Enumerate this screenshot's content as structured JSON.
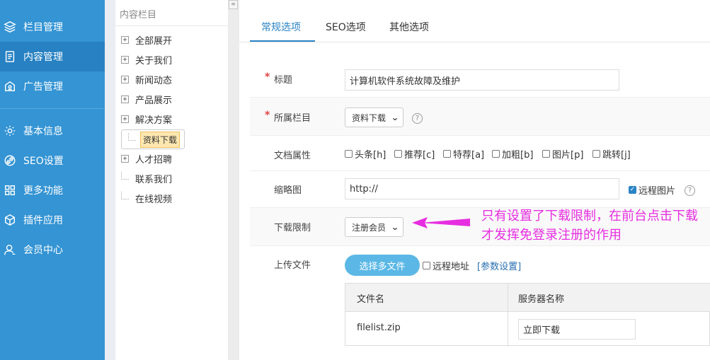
{
  "sidebar": {
    "items": [
      {
        "label": "栏目管理",
        "icon": "layers-icon"
      },
      {
        "label": "内容管理",
        "icon": "document-icon"
      },
      {
        "label": "广告管理",
        "icon": "ad-icon"
      },
      {
        "label": "基本信息",
        "icon": "gear-icon"
      },
      {
        "label": "SEO设置",
        "icon": "link-icon"
      },
      {
        "label": "更多功能",
        "icon": "grid-icon"
      },
      {
        "label": "插件应用",
        "icon": "cube-icon"
      },
      {
        "label": "会员中心",
        "icon": "user-icon"
      }
    ],
    "active": "内容管理"
  },
  "tree": {
    "title": "内容栏目",
    "nodes": [
      {
        "label": "全部展开",
        "expandable": true
      },
      {
        "label": "关于我们",
        "expandable": true
      },
      {
        "label": "新闻动态",
        "expandable": true
      },
      {
        "label": "产品展示",
        "expandable": true
      },
      {
        "label": "解决方案",
        "expandable": true
      },
      {
        "label": "资料下载",
        "expandable": false,
        "selected": true
      },
      {
        "label": "人才招聘",
        "expandable": true
      },
      {
        "label": "联系我们",
        "expandable": false
      },
      {
        "label": "在线视频",
        "expandable": false
      }
    ]
  },
  "tabs": [
    {
      "label": "常规选项",
      "active": true
    },
    {
      "label": "SEO选项"
    },
    {
      "label": "其他选项"
    }
  ],
  "form": {
    "title": {
      "label": "标题",
      "required": "*",
      "value": "计算机软件系统故障及维护"
    },
    "category": {
      "label": "所属栏目",
      "required": "*",
      "value": "资料下载"
    },
    "attributes": {
      "label": "文档属性",
      "options": [
        "头条[h]",
        "推荐[c]",
        "特荐[a]",
        "加粗[b]",
        "图片[p]",
        "跳转[j]"
      ]
    },
    "thumbnail": {
      "label": "缩略图",
      "value": "http://",
      "remote_label": "远程图片",
      "remote_checked": true
    },
    "download_limit": {
      "label": "下载限制",
      "value": "注册会员"
    },
    "upload": {
      "label": "上传文件",
      "button": "选择多文件",
      "remote_label": "远程地址",
      "param_link": "[参数设置]",
      "columns": [
        "文件名",
        "服务器名称"
      ],
      "rows": [
        {
          "file": "filelist.zip",
          "server_name": "立即下载"
        }
      ]
    }
  },
  "annotation": {
    "text": "只有设置了下载限制，在前台点击下载才发挥免登录注册的作用",
    "color": "#e62ee0"
  },
  "colors": {
    "sidebar": "#3494d4",
    "sidebar_active": "#2781c2",
    "accent": "#2a83c5"
  }
}
